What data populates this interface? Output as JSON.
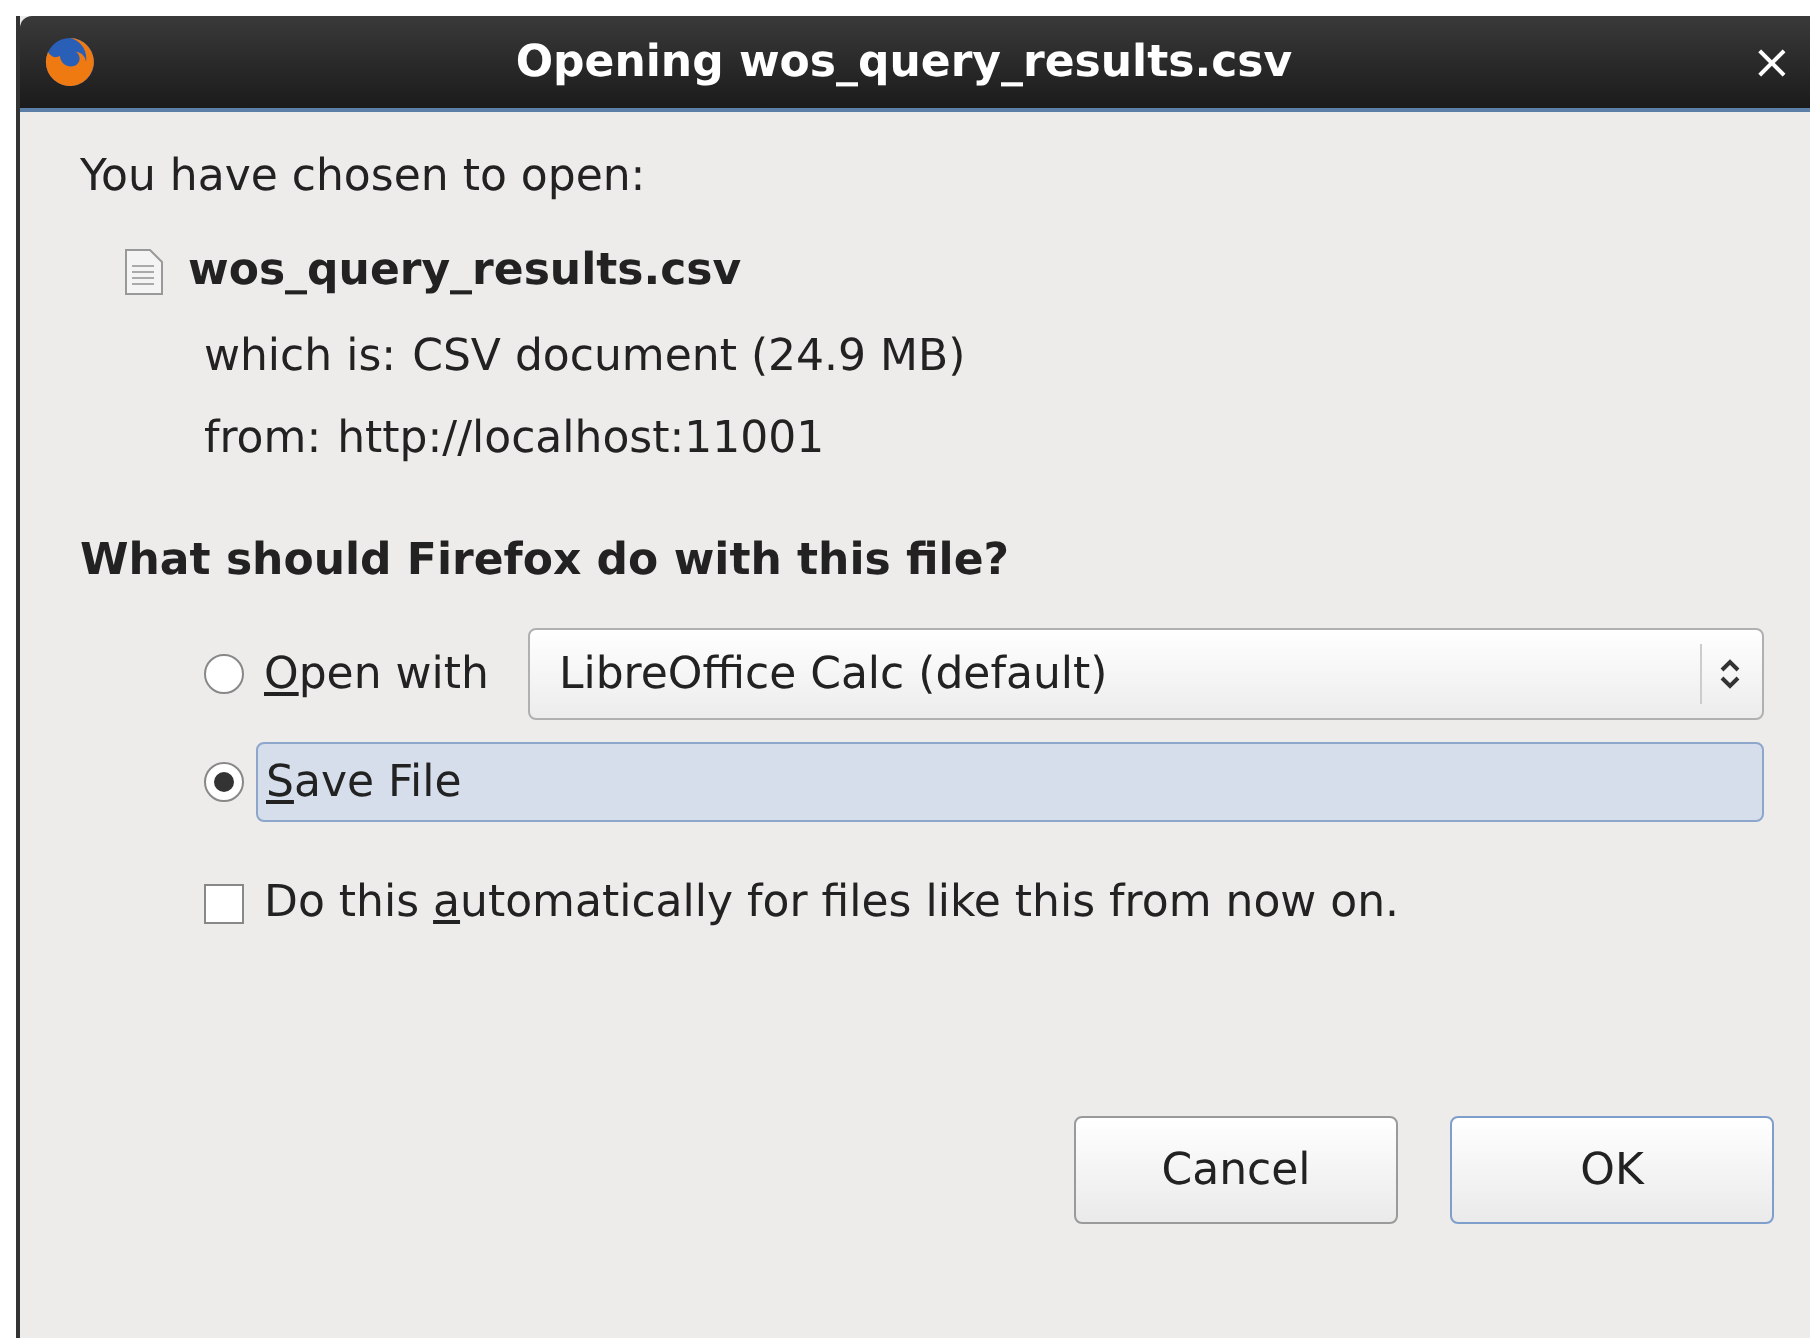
{
  "window": {
    "title": "Opening wos_query_results.csv",
    "close": "×"
  },
  "intro": "You have chosen to open:",
  "file": {
    "name": "wos_query_results.csv",
    "type_label": "which is:",
    "type": "CSV document (24.9 MB)",
    "from_label": "from:",
    "from": "http://localhost:11001"
  },
  "question": "What should Firefox do with this file?",
  "options": [
    {
      "kind": "open",
      "key": "O",
      "rest": "pen with",
      "selected": false,
      "app": "LibreOffice Calc (default)"
    },
    {
      "kind": "save",
      "key": "S",
      "rest": "ave File",
      "selected": true
    }
  ],
  "auto": {
    "before": "Do this ",
    "key": "a",
    "rest": "utomatically for files like this from now on.",
    "checked": false
  },
  "buttons": [
    {
      "label": "Cancel",
      "default": false
    },
    {
      "label": "OK",
      "default": true
    }
  ]
}
